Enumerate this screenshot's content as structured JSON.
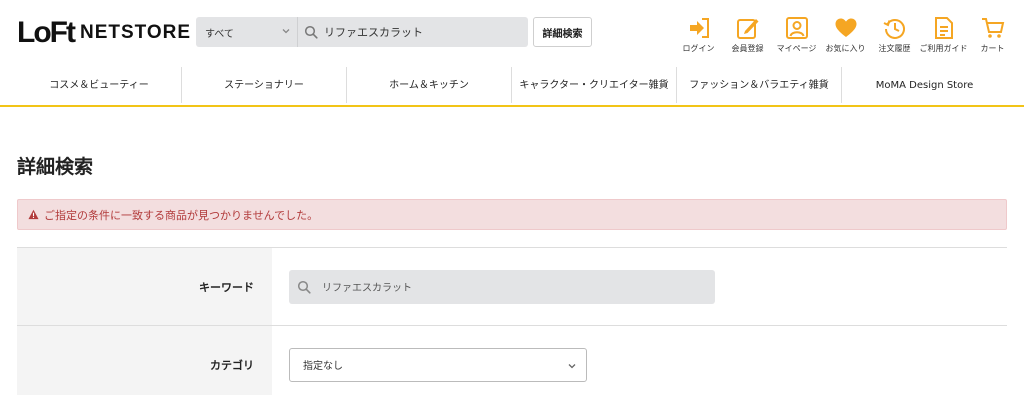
{
  "header": {
    "logo_main": "LoFt",
    "logo_sub": "NETSTORE",
    "search_scope": "すべて",
    "search_value": "リファエスカラット",
    "advanced_search_label": "詳細検索",
    "icons": [
      {
        "label": "ログイン",
        "icon": "login-icon"
      },
      {
        "label": "会員登録",
        "icon": "register-icon"
      },
      {
        "label": "マイページ",
        "icon": "mypage-icon"
      },
      {
        "label": "お気に入り",
        "icon": "heart-icon"
      },
      {
        "label": "注文履歴",
        "icon": "history-icon"
      },
      {
        "label": "ご利用ガイド",
        "icon": "guide-icon"
      },
      {
        "label": "カート",
        "icon": "cart-icon"
      }
    ],
    "accent_color": "#f5a623"
  },
  "nav": {
    "items": [
      "コスメ＆ビューティー",
      "ステーショナリー",
      "ホーム＆キッチン",
      "キャラクター・クリエイター雑貨",
      "ファッション＆バラエティ雑貨",
      "MoMA Design Store"
    ]
  },
  "main": {
    "title": "詳細検索",
    "alert": "ご指定の条件に一致する商品が見つかりませんでした。",
    "form": {
      "keyword_label": "キーワード",
      "keyword_value": "リファエスカラット",
      "category_label": "カテゴリ",
      "category_value": "指定なし"
    }
  }
}
